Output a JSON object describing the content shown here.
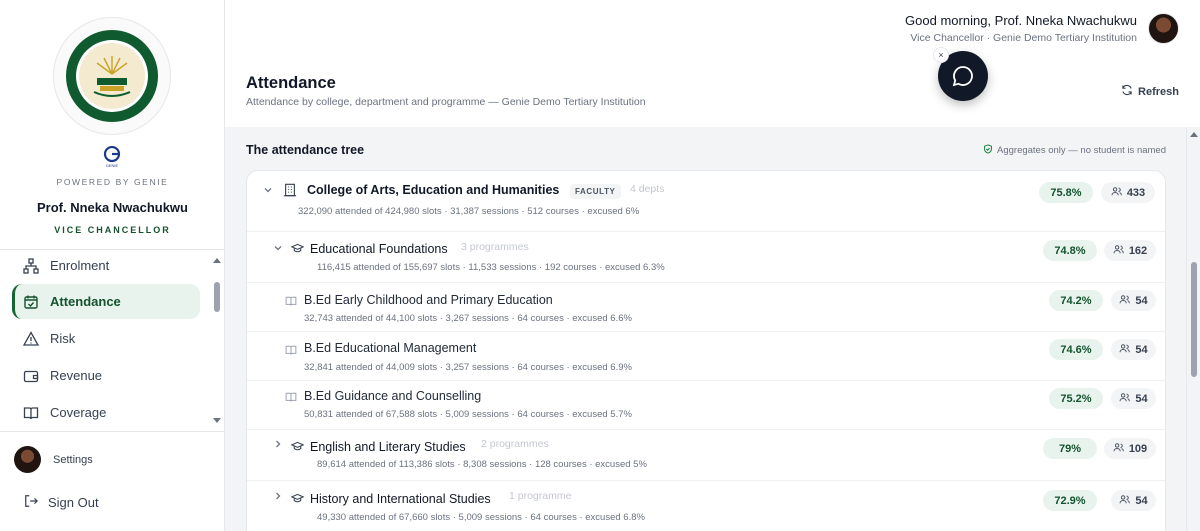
{
  "sidebar": {
    "logo_name": "Genie Demo Tertiary Institution seal",
    "powered_by": "POWERED BY GENIE",
    "genie_logo_text": "GENIE",
    "user_name": "Prof. Nneka Nwachukwu",
    "user_role": "VICE CHANCELLOR",
    "nav": [
      {
        "label": "Enrolment",
        "icon": "hierarchy-icon"
      },
      {
        "label": "Attendance",
        "icon": "calendar-check-icon",
        "active": true
      },
      {
        "label": "Risk",
        "icon": "warning-icon"
      },
      {
        "label": "Revenue",
        "icon": "wallet-icon"
      },
      {
        "label": "Coverage",
        "icon": "book-open-icon"
      }
    ],
    "settings_label": "Settings",
    "signout_label": "Sign Out"
  },
  "header": {
    "greeting": "Good morning, Prof. Nneka Nwachukwu",
    "subtitle": "Vice Chancellor · Genie Demo Tertiary Institution",
    "close_glyph": "×"
  },
  "page": {
    "title": "Attendance",
    "subtitle": "Attendance by college, department and programme — Genie Demo Tertiary Institution",
    "refresh_label": "Refresh",
    "tree_title": "The attendance tree",
    "privacy_note": "Aggregates only — no student is named"
  },
  "tree": [
    {
      "level": 0,
      "name": "College of Arts, Education and Humanities",
      "tag": "FACULTY",
      "count": "4 depts",
      "meta": "322,090 attended of 424,980 slots · 31,387 sessions · 512 courses · excused 6%",
      "pct": "75.8%",
      "people": "433"
    },
    {
      "level": 1,
      "name": "Educational Foundations",
      "count": "3 programmes",
      "meta": "116,415 attended of 155,697 slots · 11,533 sessions · 192 courses · excused 6.3%",
      "pct": "74.8%",
      "people": "162"
    },
    {
      "level": 2,
      "name": "B.Ed Early Childhood and Primary Education",
      "meta": "32,743 attended of 44,100 slots · 3,267 sessions · 64 courses · excused 6.6%",
      "pct": "74.2%",
      "people": "54"
    },
    {
      "level": 2,
      "name": "B.Ed Educational Management",
      "meta": "32,841 attended of 44,009 slots · 3,257 sessions · 64 courses · excused 6.9%",
      "pct": "74.6%",
      "people": "54"
    },
    {
      "level": 2,
      "name": "B.Ed Guidance and Counselling",
      "meta": "50,831 attended of 67,588 slots · 5,009 sessions · 64 courses · excused 5.7%",
      "pct": "75.2%",
      "people": "54"
    },
    {
      "level": 1,
      "name": "English and Literary Studies",
      "count": "2 programmes",
      "meta": "89,614 attended of 113,386 slots · 8,308 sessions · 128 courses · excused 5%",
      "pct": "79%",
      "people": "109"
    },
    {
      "level": 1,
      "name": "History and International Studies",
      "count": "1 programme",
      "meta": "49,330 attended of 67,660 slots · 5,009 sessions · 64 courses · excused 6.8%",
      "pct": "72.9%",
      "people": "54"
    }
  ],
  "colors": {
    "accent": "#14532d",
    "accent_bg": "#e8f3ee",
    "dark_fab": "#111827"
  }
}
